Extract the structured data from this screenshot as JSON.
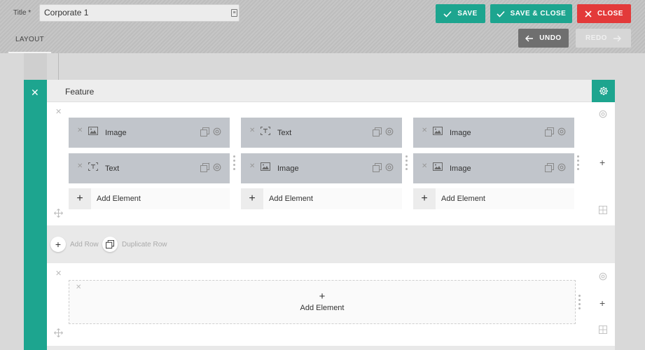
{
  "header": {
    "title_label": "Title *",
    "title_value": "Corporate 1",
    "save_label": "SAVE",
    "save_close_label": "SAVE & CLOSE",
    "close_label": "CLOSE",
    "undo_label": "UNDO",
    "redo_label": "REDO"
  },
  "tabs": [
    {
      "label": "LAYOUT",
      "active": true
    }
  ],
  "colors": {
    "accent": "#1da58f",
    "danger": "#e33a3a",
    "undo": "#6f6f6f"
  },
  "section": {
    "title": "Feature",
    "rows": [
      {
        "columns": [
          {
            "elements": [
              {
                "type": "image-icon",
                "label": "Image"
              },
              {
                "type": "text-icon",
                "label": "Text"
              }
            ],
            "add_label": "Add Element"
          },
          {
            "elements": [
              {
                "type": "text-icon",
                "label": "Text"
              },
              {
                "type": "image-icon",
                "label": "Image"
              }
            ],
            "add_label": "Add Element"
          },
          {
            "elements": [
              {
                "type": "image-icon",
                "label": "Image"
              },
              {
                "type": "image-icon",
                "label": "Image"
              }
            ],
            "add_label": "Add Element"
          }
        ]
      },
      {
        "empty_add_label": "Add Element"
      }
    ],
    "add_row_label": "Add Row",
    "duplicate_row_label": "Duplicate Row"
  }
}
